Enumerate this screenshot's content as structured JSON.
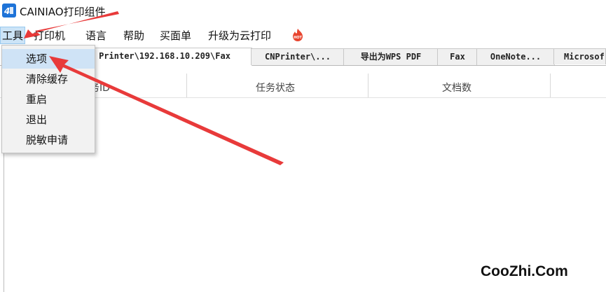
{
  "window": {
    "title": "CAINIAO打印组件",
    "icon": "app-logo-icon"
  },
  "menubar": {
    "items": [
      {
        "label": "工具"
      },
      {
        "label": "打印机"
      },
      {
        "label": "语言"
      },
      {
        "label": "帮助"
      },
      {
        "label": "买面单"
      },
      {
        "label": "升级为云打印"
      }
    ],
    "badge_icon": "hot-badge-icon"
  },
  "dropdown": {
    "items": [
      {
        "label": "选项"
      },
      {
        "label": "清除缓存"
      },
      {
        "label": "重启"
      },
      {
        "label": "退出"
      },
      {
        "label": "脱敏申请"
      }
    ]
  },
  "tabs": [
    {
      "label": "Printer\\192.168.10.209\\Fax"
    },
    {
      "label": "CNPrinter\\..."
    },
    {
      "label": "导出为WPS PDF"
    },
    {
      "label": "Fax"
    },
    {
      "label": "OneNote..."
    },
    {
      "label": "Microsof"
    }
  ],
  "table": {
    "columns": [
      "务ID",
      "任务状态",
      "文档数"
    ]
  },
  "annotation": {
    "arrow_color": "#e83a3a"
  },
  "watermark": {
    "text": "CooZhi.Com"
  }
}
